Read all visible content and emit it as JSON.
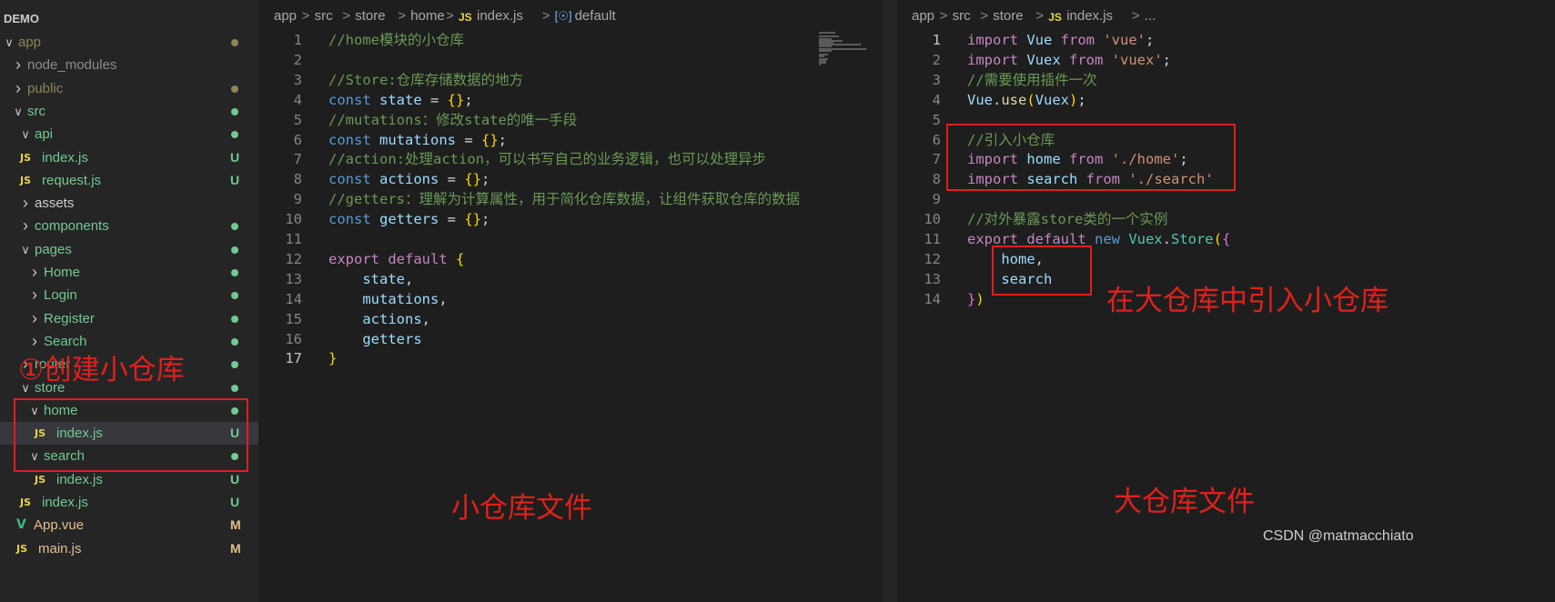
{
  "explorer": {
    "title": "DEMO",
    "items": [
      {
        "label": "app",
        "kind": "folder-open",
        "status": "dot",
        "color": "#8e8457"
      },
      {
        "label": "node_modules",
        "kind": "folder",
        "status": "none",
        "color": "#8c8c8c"
      },
      {
        "label": "public",
        "kind": "folder",
        "status": "dot",
        "color": "#8e8457"
      },
      {
        "label": "src",
        "kind": "folder-open",
        "status": "dot",
        "color": "#73c991"
      },
      {
        "label": "api",
        "kind": "folder-open",
        "status": "dot",
        "color": "#73c991"
      },
      {
        "label": "index.js",
        "kind": "js",
        "status": "U",
        "color": "#73c991"
      },
      {
        "label": "request.js",
        "kind": "js",
        "status": "U",
        "color": "#73c991"
      },
      {
        "label": "assets",
        "kind": "folder",
        "status": "none",
        "color": "#cccccc"
      },
      {
        "label": "components",
        "kind": "folder",
        "status": "dot",
        "color": "#73c991"
      },
      {
        "label": "pages",
        "kind": "folder-open",
        "status": "dot",
        "color": "#73c991"
      },
      {
        "label": "Home",
        "kind": "folder",
        "status": "dot",
        "color": "#73c991"
      },
      {
        "label": "Login",
        "kind": "folder",
        "status": "dot",
        "color": "#73c991"
      },
      {
        "label": "Register",
        "kind": "folder",
        "status": "dot",
        "color": "#73c991"
      },
      {
        "label": "Search",
        "kind": "folder",
        "status": "dot",
        "color": "#73c991"
      },
      {
        "label": "router",
        "kind": "folder",
        "status": "dot",
        "color": "#73c991"
      },
      {
        "label": "store",
        "kind": "folder-open",
        "status": "dot",
        "color": "#73c991"
      },
      {
        "label": "home",
        "kind": "folder-open",
        "status": "dot",
        "color": "#73c991"
      },
      {
        "label": "index.js",
        "kind": "js",
        "status": "U",
        "color": "#73c991"
      },
      {
        "label": "search",
        "kind": "folder-open",
        "status": "dot",
        "color": "#73c991"
      },
      {
        "label": "index.js",
        "kind": "js",
        "status": "U",
        "color": "#73c991"
      },
      {
        "label": "index.js",
        "kind": "js",
        "status": "U",
        "color": "#73c991"
      },
      {
        "label": "App.vue",
        "kind": "vue",
        "status": "M",
        "color": "#e2c08d"
      },
      {
        "label": "main.js",
        "kind": "js",
        "status": "M",
        "color": "#e2c08d"
      }
    ]
  },
  "left_editor": {
    "breadcrumb": [
      "app",
      "src",
      "store",
      "home",
      "index.js",
      "default"
    ],
    "lines": [
      [
        [
          "//home模块的小仓库",
          "com"
        ]
      ],
      [],
      [
        [
          "//Store:仓库存储数据的地方",
          "com"
        ]
      ],
      [
        [
          "const ",
          "kw"
        ],
        [
          "state",
          "var"
        ],
        [
          " = ",
          "pun"
        ],
        [
          "{}",
          "brk"
        ],
        [
          ";",
          "pun"
        ]
      ],
      [
        [
          "//mutations：修改state的唯一手段",
          "com"
        ]
      ],
      [
        [
          "const ",
          "kw"
        ],
        [
          "mutations",
          "var"
        ],
        [
          " = ",
          "pun"
        ],
        [
          "{}",
          "brk"
        ],
        [
          ";",
          "pun"
        ]
      ],
      [
        [
          "//action:处理action，可以书写自己的业务逻辑，也可以处理异步",
          "com"
        ]
      ],
      [
        [
          "const ",
          "kw"
        ],
        [
          "actions",
          "var"
        ],
        [
          " = ",
          "pun"
        ],
        [
          "{}",
          "brk"
        ],
        [
          ";",
          "pun"
        ]
      ],
      [
        [
          "//getters：理解为计算属性，用于简化仓库数据，让组件获取仓库的数据",
          "com"
        ]
      ],
      [
        [
          "const ",
          "kw"
        ],
        [
          "getters",
          "var"
        ],
        [
          " = ",
          "pun"
        ],
        [
          "{}",
          "brk"
        ],
        [
          ";",
          "pun"
        ]
      ],
      [],
      [
        [
          "export ",
          "kw2"
        ],
        [
          "default ",
          "kw2"
        ],
        [
          "{",
          "brk"
        ]
      ],
      [
        [
          "    state",
          "var"
        ],
        [
          ",",
          "pun"
        ]
      ],
      [
        [
          "    mutations",
          "var"
        ],
        [
          ",",
          "pun"
        ]
      ],
      [
        [
          "    actions",
          "var"
        ],
        [
          ",",
          "pun"
        ]
      ],
      [
        [
          "    getters",
          "var"
        ]
      ],
      [
        [
          "}",
          "brk"
        ]
      ]
    ],
    "active_line": 17
  },
  "right_editor": {
    "breadcrumb": [
      "app",
      "src",
      "store",
      "index.js",
      "..."
    ],
    "lines": [
      [
        [
          "import ",
          "kw2"
        ],
        [
          "Vue ",
          "var"
        ],
        [
          "from ",
          "kw2"
        ],
        [
          "'vue'",
          "str"
        ],
        [
          ";",
          "pun"
        ]
      ],
      [
        [
          "import ",
          "kw2"
        ],
        [
          "Vuex ",
          "var"
        ],
        [
          "from ",
          "kw2"
        ],
        [
          "'vuex'",
          "str"
        ],
        [
          ";",
          "pun"
        ]
      ],
      [
        [
          "//需要使用插件一次",
          "com"
        ]
      ],
      [
        [
          "Vue",
          "var"
        ],
        [
          ".",
          "pun"
        ],
        [
          "use",
          "fn"
        ],
        [
          "(",
          "brk"
        ],
        [
          "Vuex",
          "var"
        ],
        [
          ")",
          "brk"
        ],
        [
          ";",
          "pun"
        ]
      ],
      [],
      [
        [
          "//引入小仓库",
          "com"
        ]
      ],
      [
        [
          "import ",
          "kw2"
        ],
        [
          "home ",
          "var"
        ],
        [
          "from ",
          "kw2"
        ],
        [
          "'./home'",
          "str"
        ],
        [
          ";",
          "pun"
        ]
      ],
      [
        [
          "import ",
          "kw2"
        ],
        [
          "search ",
          "var"
        ],
        [
          "from ",
          "kw2"
        ],
        [
          "'./search'",
          "str"
        ]
      ],
      [],
      [
        [
          "//对外暴露store类的一个实例",
          "com"
        ]
      ],
      [
        [
          "export ",
          "kw2"
        ],
        [
          "default ",
          "kw2"
        ],
        [
          "new ",
          "kw"
        ],
        [
          "Vuex",
          "cls"
        ],
        [
          ".",
          "pun"
        ],
        [
          "Store",
          "cls"
        ],
        [
          "(",
          "brk"
        ],
        [
          "{",
          "brk2"
        ]
      ],
      [
        [
          "    home",
          "var"
        ],
        [
          ",",
          "pun"
        ]
      ],
      [
        [
          "    search",
          "var"
        ]
      ],
      [
        [
          "}",
          "brk2"
        ],
        [
          ")",
          "brk"
        ]
      ]
    ],
    "active_line": 1
  },
  "annotations": {
    "create_store": "①创建小仓库",
    "small_store_file": "小仓库文件",
    "import_small_store": "在大仓库中引入小仓库",
    "big_store_file": "大仓库文件",
    "watermark": "CSDN @matmacchiato"
  }
}
